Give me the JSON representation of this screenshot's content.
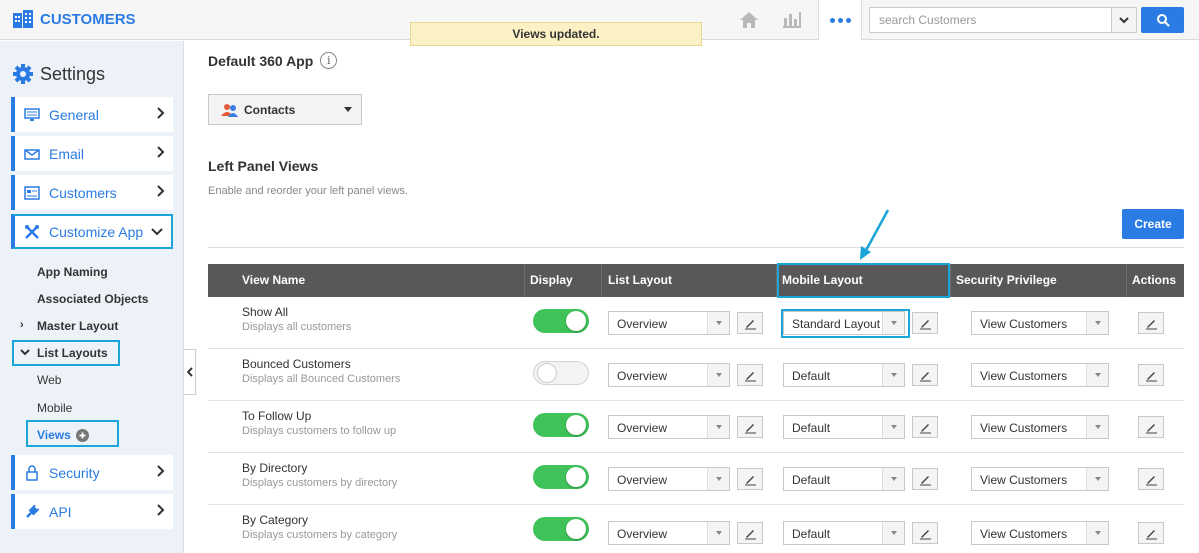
{
  "app": {
    "title": "CUSTOMERS",
    "toast": "Views updated."
  },
  "topbar": {
    "icons": [
      "home-icon",
      "chart-icon",
      "more-icon"
    ],
    "search": {
      "placeholder": "search Customers"
    }
  },
  "sidebar": {
    "title": "Settings",
    "items": [
      {
        "label": "General",
        "icon": "monitor-icon"
      },
      {
        "label": "Email",
        "icon": "envelope-icon"
      },
      {
        "label": "Customers",
        "icon": "list-icon"
      },
      {
        "label": "Customize App",
        "icon": "tools-icon"
      }
    ],
    "customize_sub": [
      "App Naming",
      "Associated Objects",
      "Master Layout",
      "List Layouts"
    ],
    "list_layouts_sub": [
      "Web",
      "Mobile",
      "Views"
    ],
    "bottom_items": [
      {
        "label": "Security",
        "icon": "lock-icon"
      },
      {
        "label": "API",
        "icon": "plug-icon"
      }
    ]
  },
  "main": {
    "title": "Default 360 App",
    "app_select": "Contacts",
    "section_title": "Left Panel Views",
    "section_sub": "Enable and reorder your left panel views.",
    "create_label": "Create",
    "columns": [
      "View Name",
      "Display",
      "List Layout",
      "Mobile Layout",
      "Security Privilege",
      "Actions"
    ],
    "rows": [
      {
        "name": "Show All",
        "desc": "Displays all customers",
        "display": true,
        "list_layout": "Overview",
        "mobile_layout": "Standard Layout",
        "security": "View Customers"
      },
      {
        "name": "Bounced Customers",
        "desc": "Displays all Bounced Customers",
        "display": false,
        "list_layout": "Overview",
        "mobile_layout": "Default",
        "security": "View Customers"
      },
      {
        "name": "To Follow Up",
        "desc": "Displays customers to follow up",
        "display": true,
        "list_layout": "Overview",
        "mobile_layout": "Default",
        "security": "View Customers"
      },
      {
        "name": "By Directory",
        "desc": "Displays customers by directory",
        "display": true,
        "list_layout": "Overview",
        "mobile_layout": "Default",
        "security": "View Customers"
      },
      {
        "name": "By Category",
        "desc": "Displays customers by category",
        "display": true,
        "list_layout": "Overview",
        "mobile_layout": "Default",
        "security": "View Customers"
      }
    ]
  },
  "colors": {
    "accent": "#2a7be4",
    "highlight": "#19a5d8",
    "toggle_on": "#3fc25a",
    "header_bg": "#585858",
    "toast_bg": "#fcf1c4"
  }
}
